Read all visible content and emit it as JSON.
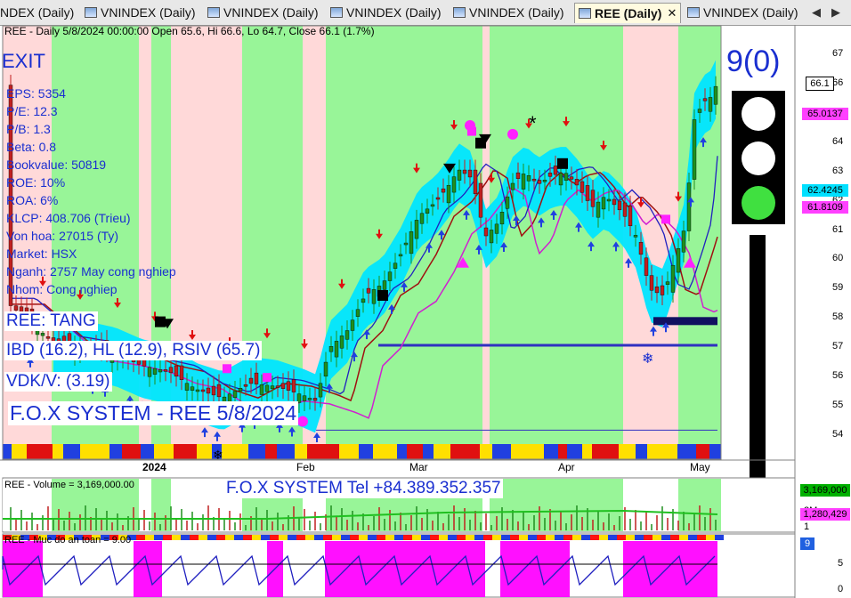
{
  "tabs": [
    {
      "label": "NDEX (Daily)",
      "active": false
    },
    {
      "label": "VNINDEX (Daily)",
      "active": false
    },
    {
      "label": "VNINDEX (Daily)",
      "active": false
    },
    {
      "label": "VNINDEX (Daily)",
      "active": false
    },
    {
      "label": "VNINDEX (Daily)",
      "active": false
    },
    {
      "label": "REE (Daily)",
      "active": true
    },
    {
      "label": "VNINDEX (Daily)",
      "active": false
    }
  ],
  "tab_close": "✕",
  "tab_nav_prev": "◀",
  "tab_nav_next": "▶",
  "main_header": "REE - Daily 5/8/2024 00:00:00 Open 65.6, Hi 66.6, Lo 64.7, Close 66.1 (1.7%)",
  "exit_label": "EXIT",
  "signal_count": "9(0)",
  "fundamentals": [
    "EPS: 5354",
    "P/E: 12.3",
    "P/B: 1.3",
    "Beta: 0.8",
    "Bookvalue: 50819",
    "ROE: 10%",
    "ROA: 6%",
    "KLCP: 408.706 (Trieu)",
    "Von hoa: 27015 (Ty)",
    "Market: HSX",
    "Nganh: 2757 May cong nghiep",
    "Nhom: Cong nghiep"
  ],
  "trend_label": "REE: TANG",
  "ibd_label": "IBD (16.2), HL (12.9), RSIV (65.7)",
  "vdk_label": "VDK/V:  (3.19)",
  "system_label": "F.O.X SYSTEM - REE 5/8/2024",
  "star_mark": "*",
  "snow_mark": "❄",
  "price_axis": [
    "67",
    "66",
    "65",
    "64",
    "63",
    "62",
    "61",
    "60",
    "59",
    "58",
    "57",
    "56",
    "55",
    "54"
  ],
  "price_tags": [
    {
      "text": "66.1",
      "color": "#ffffff",
      "text_color": "#000000"
    },
    {
      "text": "65.0137",
      "color": "#ff40ff",
      "text_color": "#000000"
    },
    {
      "text": "62.4245",
      "color": "#00e0ff",
      "text_color": "#000000"
    },
    {
      "text": "61.8109",
      "color": "#ff40ff",
      "text_color": "#000000"
    }
  ],
  "time_axis": [
    "2024",
    "Feb",
    "Mar",
    "Apr",
    "May"
  ],
  "volume_header": "REE - Volume = 3,169,000.00",
  "volume_banner": "F.O.X SYSTEM Tel +84.389.352.357",
  "volume_axis": [
    "2M",
    "1"
  ],
  "volume_tags": [
    {
      "text": "3,169,000",
      "color": "#00b000"
    },
    {
      "text": "1,280,429",
      "color": "#ff40ff"
    }
  ],
  "safety_header": "REE - Muc do an toan = 9.00",
  "safety_axis": [
    "5",
    "0"
  ],
  "safety_tag": "9",
  "colors": {
    "bull_zone": "#98f598",
    "bear_zone": "#ffd9d9",
    "channel": "#00e5ff",
    "candle_up": "#1f8f1f",
    "candle_down": "#c02020",
    "ma_red": "#a01010",
    "ma_magenta": "#d020d0",
    "ma_blue": "#2020c0",
    "text_blue": "#1a2fd0"
  },
  "traffic_light": [
    "white",
    "white",
    "green"
  ]
}
